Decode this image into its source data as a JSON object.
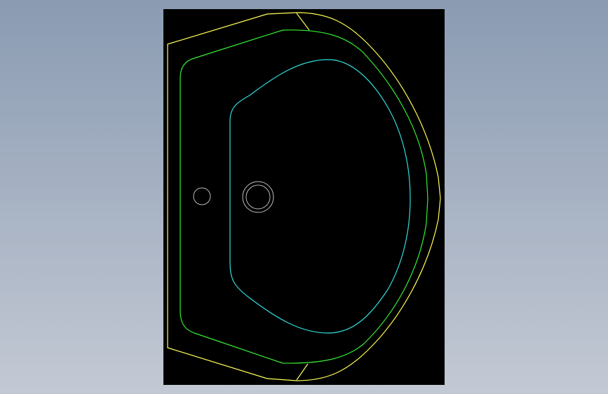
{
  "viewport": {
    "background_top": "#8a9bb2",
    "background_bottom": "#c3c9d4"
  },
  "canvas": {
    "background": "#000000"
  },
  "outlines": {
    "outer_rim_color": "#ffff55",
    "inner_rim_color": "#33ee33",
    "basin_color": "#33dddd",
    "hole_color": "#b8b8b8"
  }
}
